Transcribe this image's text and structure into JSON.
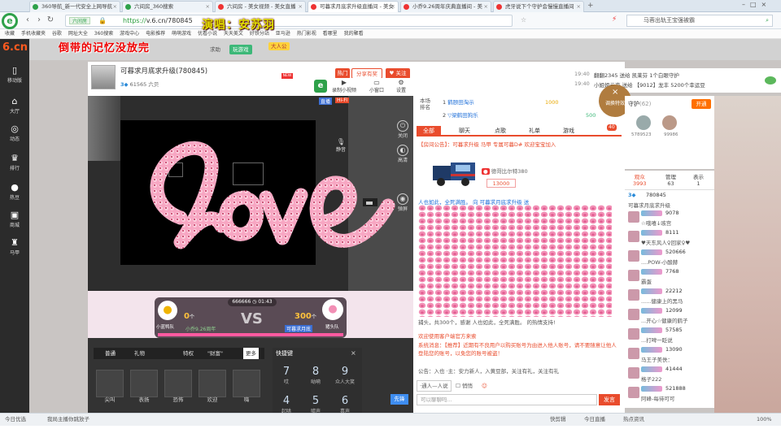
{
  "browser": {
    "tabs": [
      {
        "label": "360导航_新一代安全上网导航",
        "color": "#2ea14a",
        "active": false
      },
      {
        "label": "六间房_360搜索",
        "color": "#2ea14a",
        "active": false
      },
      {
        "label": "六间房 - 美女视频 - 美女直播",
        "color": "#e33",
        "active": false
      },
      {
        "label": "可暮求月底求升级直播间 - 美女",
        "color": "#e33",
        "active": true
      },
      {
        "label": "小乔9.26周年庆典直播间 - 美",
        "color": "#e33",
        "active": false
      },
      {
        "label": "虎牙说下个守护会慢慢直播间",
        "color": "#e33",
        "active": false
      }
    ],
    "url_badge": "六间房",
    "url_scheme": "https://",
    "url_path": "v.6.cn/780845",
    "search_text": "马蓉出轨王宝强被霸",
    "bookmarks": [
      "收藏",
      "手机收藏夹",
      "谷歌",
      "网址大全",
      "360搜索",
      "游戏中心",
      "电影推荐",
      "萌萌游戏",
      "优看小说",
      "天天美文",
      "好铁分站",
      "亚马逊",
      "热门影视",
      "看哪里",
      "我的聚看"
    ]
  },
  "overlay": {
    "song_title": "演唱：安苏羽",
    "lyrics": "倒带的记忆没放完"
  },
  "leftnav": {
    "logo": "6.cn",
    "items": [
      {
        "label": "移动版",
        "icon": "phone-icon"
      },
      {
        "label": "大厅",
        "icon": "home-icon"
      },
      {
        "label": "动态",
        "icon": "compass-icon"
      },
      {
        "label": "排行",
        "icon": "trophy-icon"
      },
      {
        "label": "热豆",
        "icon": "bean-icon"
      },
      {
        "label": "商城",
        "icon": "shop-icon"
      },
      {
        "label": "马甲",
        "icon": "vest-icon"
      }
    ]
  },
  "sitebar": {
    "search_hint": "求助",
    "game_label": "玩游戏",
    "vip_label": "大人公"
  },
  "host": {
    "name": "可暮求月底求升级",
    "room_id": "(780845)",
    "level_text": "61565 六贝",
    "follow_label": "关注",
    "share_label": "分享有奖",
    "hot_label": "热门",
    "new_label": "NEW"
  },
  "tools": {
    "items": [
      "录制小视频",
      "小窗口",
      "设置"
    ]
  },
  "video": {
    "quality_label": "直播",
    "hifi_label": "Hi-Fi",
    "side_controls": [
      "关闭",
      "高清",
      "弹屏"
    ],
    "mic_label": "静音"
  },
  "pk": {
    "timer": "01:43",
    "timer_id": "666666",
    "left_score": "0",
    "left_unit": "个",
    "right_score": "300",
    "right_unit": "个",
    "vs": "VS",
    "left_name": "小乔9.26周年",
    "right_name": "可暮求月底",
    "left_tag": "小蓝鸭队",
    "right_tag": "猪头队",
    "left_share": 0
  },
  "gift": {
    "tabs": [
      "普通",
      "礼物",
      "特权",
      "\"财富\"",
      "更多"
    ],
    "items": [
      "尖叫",
      "表扬",
      "恐怖",
      "欢迎",
      "嗨"
    ]
  },
  "keypad": {
    "title": "快捷键",
    "keys": [
      {
        "num": "7",
        "sub": "哎"
      },
      {
        "num": "8",
        "sub": "呦嗬"
      },
      {
        "num": "9",
        "sub": "众人大笑"
      },
      {
        "num": "4",
        "sub": "起哄"
      },
      {
        "num": "5",
        "sub": "嘘声"
      },
      {
        "num": "6",
        "sub": "喜声"
      }
    ]
  },
  "chat": {
    "rank_title": "本场排名",
    "ranks": [
      {
        "pos": "1",
        "name": "鹤颐田淘示",
        "value": "1000"
      },
      {
        "pos": "2",
        "name": "▽梁鹤田狗乐",
        "value": "500"
      }
    ],
    "tabs": [
      "全部",
      "聊天",
      "点歌",
      "礼单",
      "游戏"
    ],
    "tab_badge": "40",
    "notice": "【房间公告】：可暮求升级 马甲 专属可暮D# 欢迎宝宝加入",
    "truck_caption": "德哥比尔特380",
    "truck_value": "13000",
    "line1": "人也如此，全死满胜。  向 可暮求月底求升级 送",
    "line2": "捕头，共300个，感谢 人也如此，全死满胜。 的热情支持!",
    "sys1": "欢迎使用客户端官方来索",
    "sys2": "系统消息：【推荐】近期有不良用户以购买账号为由进入他人账号，请不要随意让他人登陆您的账号，以免您的账号被盗！",
    "guide": "公告：入也 ·主：安力新人，入黄豆部，关注有礼，关注有礼",
    "whisper_label": "·通人—人说",
    "checkbox_label": "悄悄",
    "input_placeholder": "可以聊聊吗...",
    "send_label": "发言"
  },
  "right": {
    "top_line1": "翻翻2345 送给 凯莱芬 1个白眼守护",
    "top_line2": "小姐姐云恋 送给 【9012】龙丰  5200个幸运豆",
    "time1": "19:40",
    "time2": "19:40",
    "guard_title": "守护",
    "guard_count": "(62)",
    "guard_btn": "开通",
    "guard_ids": [
      "5789523",
      "99986"
    ],
    "fan_tabs": [
      {
        "label": "观众",
        "count": "3993"
      },
      {
        "label": "管理",
        "count": "63"
      },
      {
        "label": "表示",
        "count": "1"
      }
    ],
    "fans": [
      {
        "id": "780845",
        "name": "可暮求月底求升级"
      },
      {
        "id": "9078",
        "name": "☆哦嘻↓咳宫"
      },
      {
        "id": "8111",
        "name": "♥天东风人♀回家♀♥"
      },
      {
        "id": "520666",
        "name": "....POW-小酸赫"
      },
      {
        "id": "7768",
        "name": "霸蛋"
      },
      {
        "id": "22212",
        "name": "......健康上的黑马"
      },
      {
        "id": "12099",
        "name": "...开心☆健康的鹤子"
      },
      {
        "id": "57585",
        "name": "...打啤一眨说"
      },
      {
        "id": "13090",
        "name": "马王子美佚："
      },
      {
        "id": "41444",
        "name": "格子222"
      },
      {
        "id": "521888",
        "name": "阿峰-每待可可"
      }
    ],
    "close_effect": "调换特效"
  },
  "statusbar": {
    "items": [
      "今日优选",
      "我局主播你跳放子",
      "快剪辑",
      "今日直播",
      "热点资讯",
      "100%"
    ]
  }
}
